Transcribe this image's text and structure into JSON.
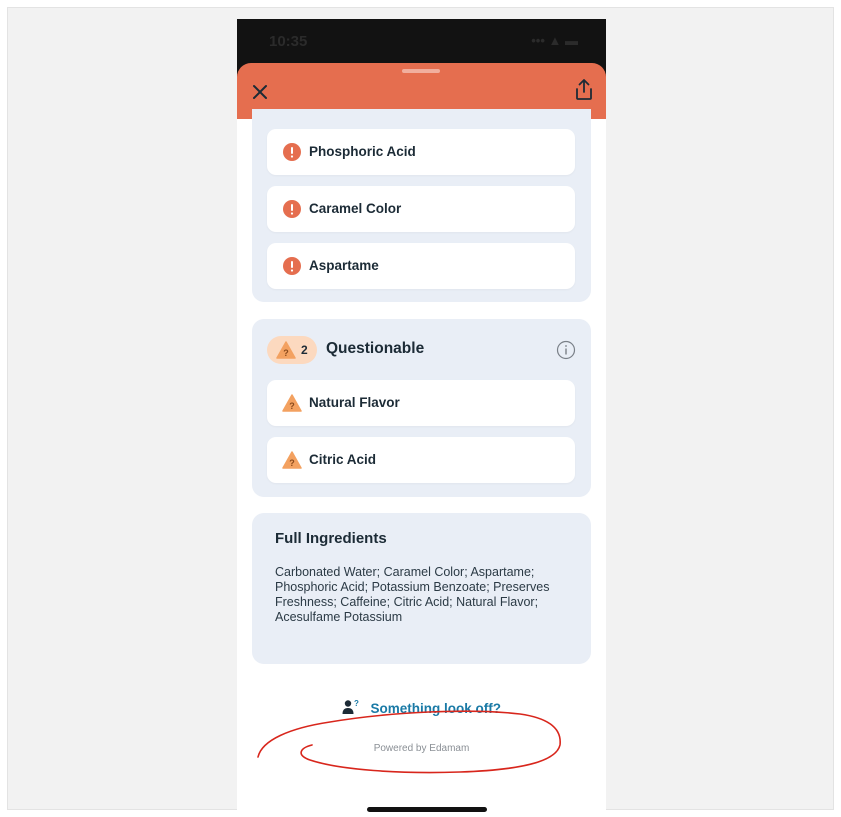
{
  "status_bar": {
    "time": "10:35",
    "signal": "••• ▲ ▬"
  },
  "header": {
    "close_icon": "close-icon",
    "share_icon": "share-icon"
  },
  "harmful_items": [
    {
      "label": "Phosphoric Acid"
    },
    {
      "label": "Caramel Color"
    },
    {
      "label": "Aspartame"
    }
  ],
  "questionable": {
    "count": "2",
    "title": "Questionable",
    "items": [
      {
        "label": "Natural Flavor"
      },
      {
        "label": "Citric Acid"
      }
    ]
  },
  "full_ingredients": {
    "title": "Full Ingredients",
    "text": "Carbonated Water; Caramel Color; Aspartame; Phosphoric Acid; Potassium Benzoate; Preserves Freshness; Caffeine; Citric Acid; Natural Flavor; Acesulfame Potassium"
  },
  "report_link": "Something look off?",
  "powered_by": "Powered by Edamam",
  "colors": {
    "header": "#e56e4f",
    "harmful": "#e56e4f",
    "warning": "#f3a160",
    "panel": "#e9eef6",
    "link": "#1a7aa6",
    "annotation": "#d8261c"
  }
}
